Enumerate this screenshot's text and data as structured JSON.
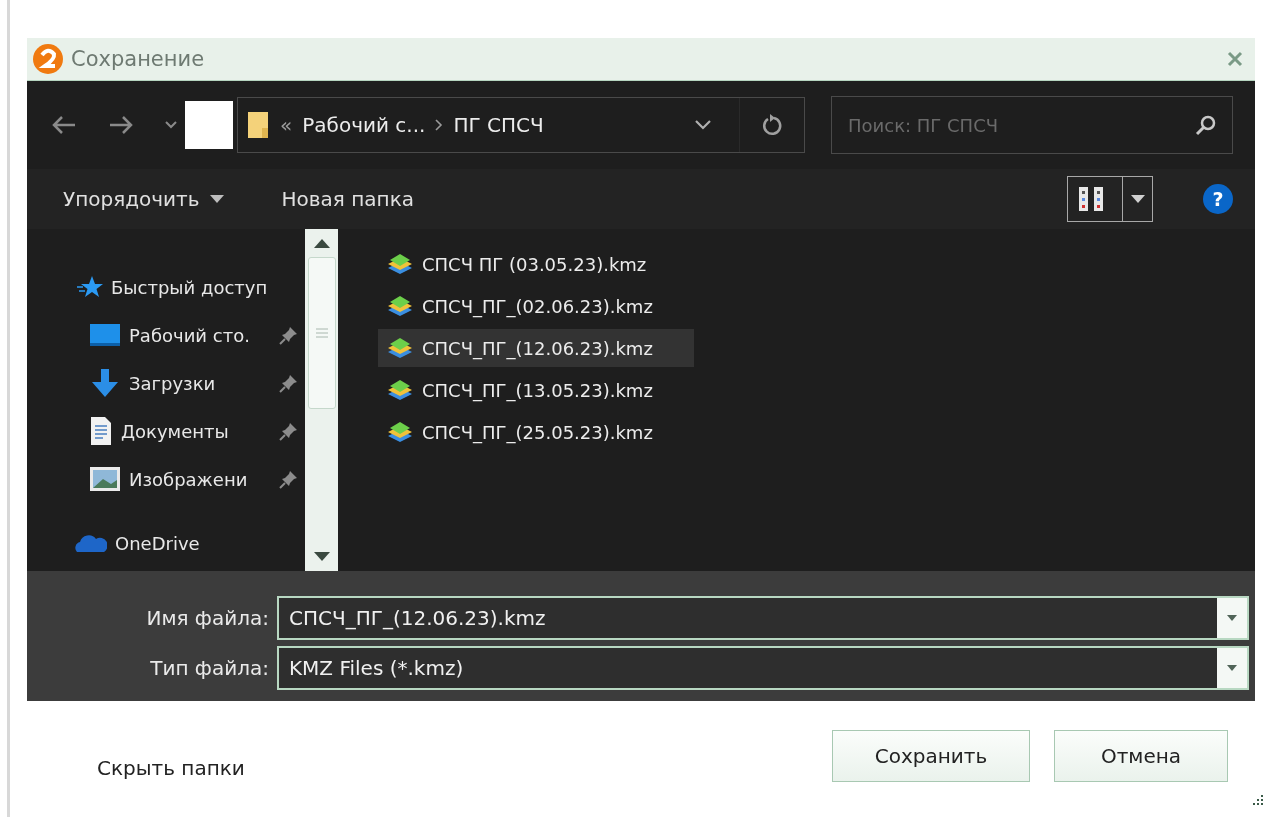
{
  "window": {
    "title": "Сохранение"
  },
  "address": {
    "overflow": "«",
    "crumbs": [
      "Рабочий с...",
      "ПГ СПСЧ"
    ]
  },
  "search": {
    "placeholder": "Поиск: ПГ СПСЧ"
  },
  "toolbar": {
    "organize": "Упорядочить",
    "new_folder": "Новая папка",
    "help": "?"
  },
  "sidebar": {
    "items": [
      {
        "kind": "quick",
        "label": "Быстрый доступ",
        "pinned": false
      },
      {
        "kind": "desktop",
        "label": "Рабочий сто.",
        "pinned": true
      },
      {
        "kind": "downloads",
        "label": "Загрузки",
        "pinned": true
      },
      {
        "kind": "documents",
        "label": "Документы",
        "pinned": true
      },
      {
        "kind": "pictures",
        "label": "Изображени",
        "pinned": true
      },
      {
        "kind": "cloud",
        "label": "OneDrive",
        "pinned": false
      }
    ]
  },
  "files": [
    {
      "name": "СПСЧ ПГ (03.05.23).kmz",
      "selected": false
    },
    {
      "name": "СПСЧ_ПГ_(02.06.23).kmz",
      "selected": false
    },
    {
      "name": "СПСЧ_ПГ_(12.06.23).kmz",
      "selected": true
    },
    {
      "name": "СПСЧ_ПГ_(13.05.23).kmz",
      "selected": false
    },
    {
      "name": "СПСЧ_ПГ_(25.05.23).kmz",
      "selected": false
    }
  ],
  "fields": [
    {
      "label": "Имя файла:",
      "value": "СПСЧ_ПГ_(12.06.23).kmz"
    },
    {
      "label": "Тип файла:",
      "value": "KMZ Files (*.kmz)"
    }
  ],
  "hide_folders": "Скрыть папки",
  "buttons": [
    "Сохранить",
    "Отмена"
  ]
}
